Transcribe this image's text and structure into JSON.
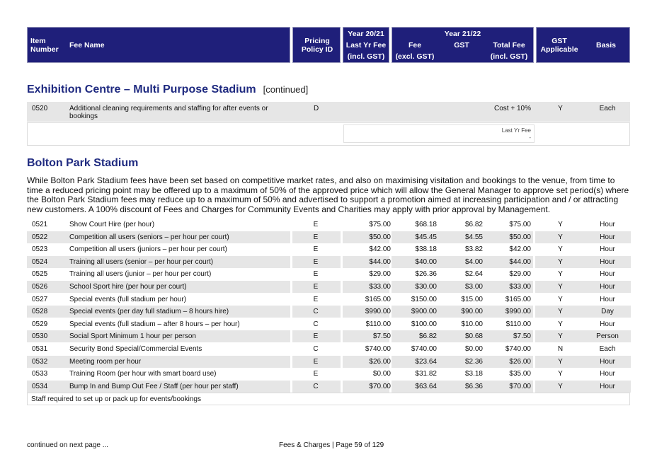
{
  "header": {
    "item_number": "Item Number",
    "fee_name": "Fee Name",
    "pricing_policy": "Pricing Policy ID",
    "year_prev": "Year 20/21",
    "last_yr_fee": "Last Yr Fee",
    "incl_gst": "(incl. GST)",
    "year_curr": "Year 21/22",
    "fee": "Fee",
    "excl_gst": "(excl. GST)",
    "gst": "GST",
    "total_fee": "Total Fee",
    "incl_gst2": "(incl. GST)",
    "gst_applicable": "GST Applicable",
    "basis": "Basis"
  },
  "section1": {
    "title": "Exhibition Centre – Multi Purpose Stadium",
    "continued": "[continued]",
    "row": {
      "num": "0520",
      "name": "Additional cleaning requirements and staffing for after events or bookings",
      "policy": "D",
      "total": "Cost + 10%",
      "gst_applicable": "Y",
      "basis": "Each"
    },
    "last_yr_label": "Last Yr Fee",
    "last_yr_value": "-"
  },
  "section2": {
    "title": "Bolton Park Stadium",
    "intro": "While Bolton Park Stadium fees have been set based on competitive market rates, and also on maximising visitation and bookings to the venue, from time to time a reduced pricing point may be offered up to a maximum of 50% of the approved price which will allow the General Manager to approve set period(s) where the Bolton Park Stadium fees may reduce up to a maximum of 50% and advertised to support a promotion aimed at increasing participation and / or attracting new customers. A 100% discount of Fees and Charges for Community Events and Charities may apply with prior approval by Management.",
    "rows": [
      [
        "0521",
        "Show Court Hire (per hour)",
        "E",
        "$75.00",
        "$68.18",
        "$6.82",
        "$75.00",
        "Y",
        "Hour"
      ],
      [
        "0522",
        "Competition all users (seniors – per hour per court)",
        "E",
        "$50.00",
        "$45.45",
        "$4.55",
        "$50.00",
        "Y",
        "Hour"
      ],
      [
        "0523",
        "Competition all users (juniors – per hour per court)",
        "E",
        "$42.00",
        "$38.18",
        "$3.82",
        "$42.00",
        "Y",
        "Hour"
      ],
      [
        "0524",
        "Training all users  (senior – per hour per court)",
        "E",
        "$44.00",
        "$40.00",
        "$4.00",
        "$44.00",
        "Y",
        "Hour"
      ],
      [
        "0525",
        "Training all users  (junior – per hour per court)",
        "E",
        "$29.00",
        "$26.36",
        "$2.64",
        "$29.00",
        "Y",
        "Hour"
      ],
      [
        "0526",
        "School Sport hire (per hour per court)",
        "E",
        "$33.00",
        "$30.00",
        "$3.00",
        "$33.00",
        "Y",
        "Hour"
      ],
      [
        "0527",
        "Special events (full stadium per hour)",
        "E",
        "$165.00",
        "$150.00",
        "$15.00",
        "$165.00",
        "Y",
        "Hour"
      ],
      [
        "0528",
        "Special events (per day full stadium  – 8 hours hire)",
        "C",
        "$990.00",
        "$900.00",
        "$90.00",
        "$990.00",
        "Y",
        "Day"
      ],
      [
        "0529",
        "Special events (full stadium  – after 8 hours – per hour)",
        "C",
        "$110.00",
        "$100.00",
        "$10.00",
        "$110.00",
        "Y",
        "Hour"
      ],
      [
        "0530",
        "Social Sport Minimum 1 hour per person",
        "E",
        "$7.50",
        "$6.82",
        "$0.68",
        "$7.50",
        "Y",
        "Person"
      ],
      [
        "0531",
        "Security Bond Special/Commercial Events",
        "C",
        "$740.00",
        "$740.00",
        "$0.00",
        "$740.00",
        "N",
        "Each"
      ],
      [
        "0532",
        "Meeting room per hour",
        "E",
        "$26.00",
        "$23.64",
        "$2.36",
        "$26.00",
        "Y",
        "Hour"
      ],
      [
        "0533",
        "Training Room (per hour with smart board use)",
        "E",
        "$0.00",
        "$31.82",
        "$3.18",
        "$35.00",
        "Y",
        "Hour"
      ],
      [
        "0534",
        "Bump In and Bump Out Fee / Staff (per hour per staff)",
        "C",
        "$70.00",
        "$63.64",
        "$6.36",
        "$70.00",
        "Y",
        "Hour"
      ]
    ],
    "note": "Staff required to set up or pack up for events/bookings"
  },
  "footer": {
    "continued": "continued on next page ...",
    "page": "Fees & Charges | Page 59 of 129"
  },
  "colors": {
    "header_bg": "#1f1f7a",
    "title": "#1f2a80",
    "row_shade": "#e6e6e6"
  }
}
